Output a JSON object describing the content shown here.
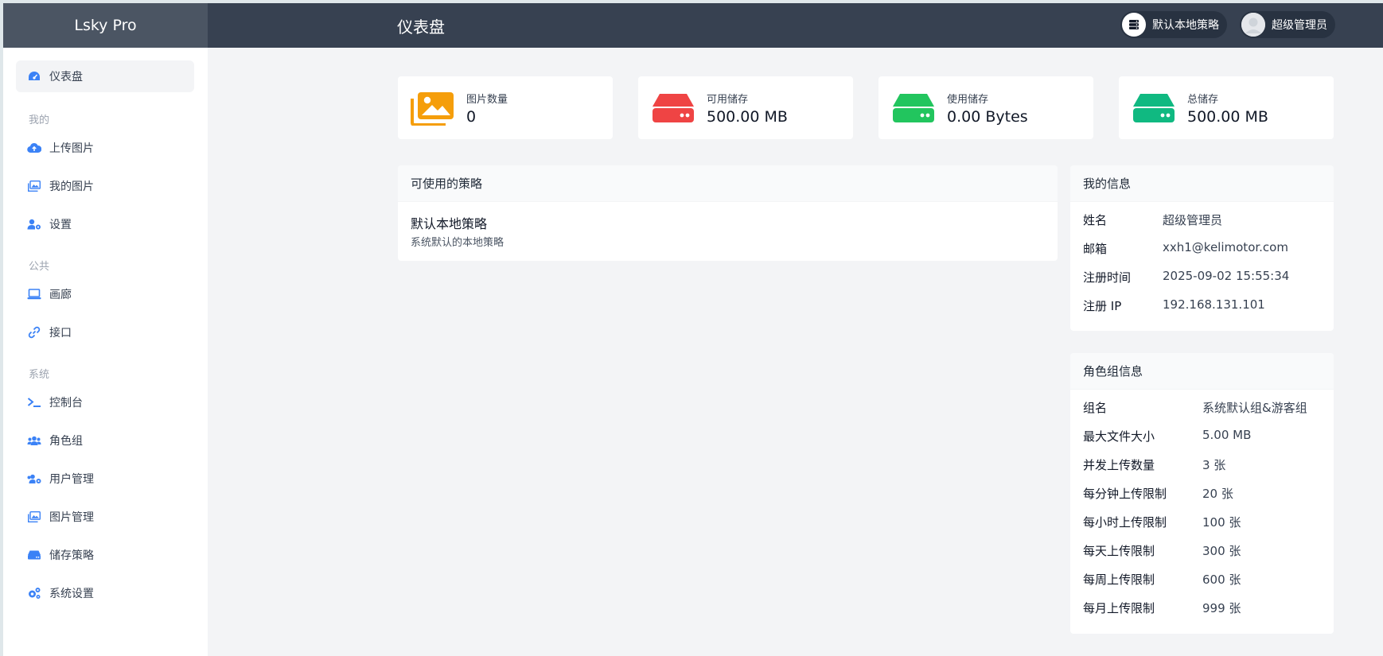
{
  "app": {
    "brand": "Lsky Pro",
    "page_title": "仪表盘"
  },
  "topbar": {
    "strategy_label": "默认本地策略",
    "user_label": "超级管理员"
  },
  "sidebar": {
    "dashboard": "仪表盘",
    "group_mine": "我的",
    "upload": "上传图片",
    "my_images": "我的图片",
    "settings": "设置",
    "group_public": "公共",
    "gallery": "画廊",
    "api": "接口",
    "group_system": "系统",
    "console": "控制台",
    "roles": "角色组",
    "users": "用户管理",
    "images_admin": "图片管理",
    "storage": "储存策略",
    "system_settings": "系统设置"
  },
  "stats": [
    {
      "label": "图片数量",
      "value": "0",
      "icon": "images-icon",
      "color": "#f59e0b"
    },
    {
      "label": "可用储存",
      "value": "500.00 MB",
      "icon": "hdd-icon",
      "color": "#ef4444"
    },
    {
      "label": "使用储存",
      "value": "0.00 Bytes",
      "icon": "hdd-icon",
      "color": "#22c55e"
    },
    {
      "label": "总储存",
      "value": "500.00 MB",
      "icon": "hdd-icon",
      "color": "#10b981"
    }
  ],
  "strategies": {
    "title": "可使用的策略",
    "name": "默认本地策略",
    "desc": "系统默认的本地策略"
  },
  "my_info": {
    "title": "我的信息",
    "rows": [
      {
        "k": "姓名",
        "v": "超级管理员"
      },
      {
        "k": "邮箱",
        "v": "xxh1@kelimotor.com"
      },
      {
        "k": "注册时间",
        "v": "2025-09-02 15:55:34"
      },
      {
        "k": "注册 IP",
        "v": "192.168.131.101"
      }
    ]
  },
  "role_info": {
    "title": "角色组信息",
    "rows": [
      {
        "k": "组名",
        "v": "系统默认组&游客组"
      },
      {
        "k": "最大文件大小",
        "v": "5.00 MB"
      },
      {
        "k": "并发上传数量",
        "v": "3 张"
      },
      {
        "k": "每分钟上传限制",
        "v": "20 张"
      },
      {
        "k": "每小时上传限制",
        "v": "100 张"
      },
      {
        "k": "每天上传限制",
        "v": "300 张"
      },
      {
        "k": "每周上传限制",
        "v": "600 张"
      },
      {
        "k": "每月上传限制",
        "v": "999 张"
      }
    ]
  },
  "colors": {
    "topbar": "#374151",
    "accent": "#3b82f6"
  }
}
